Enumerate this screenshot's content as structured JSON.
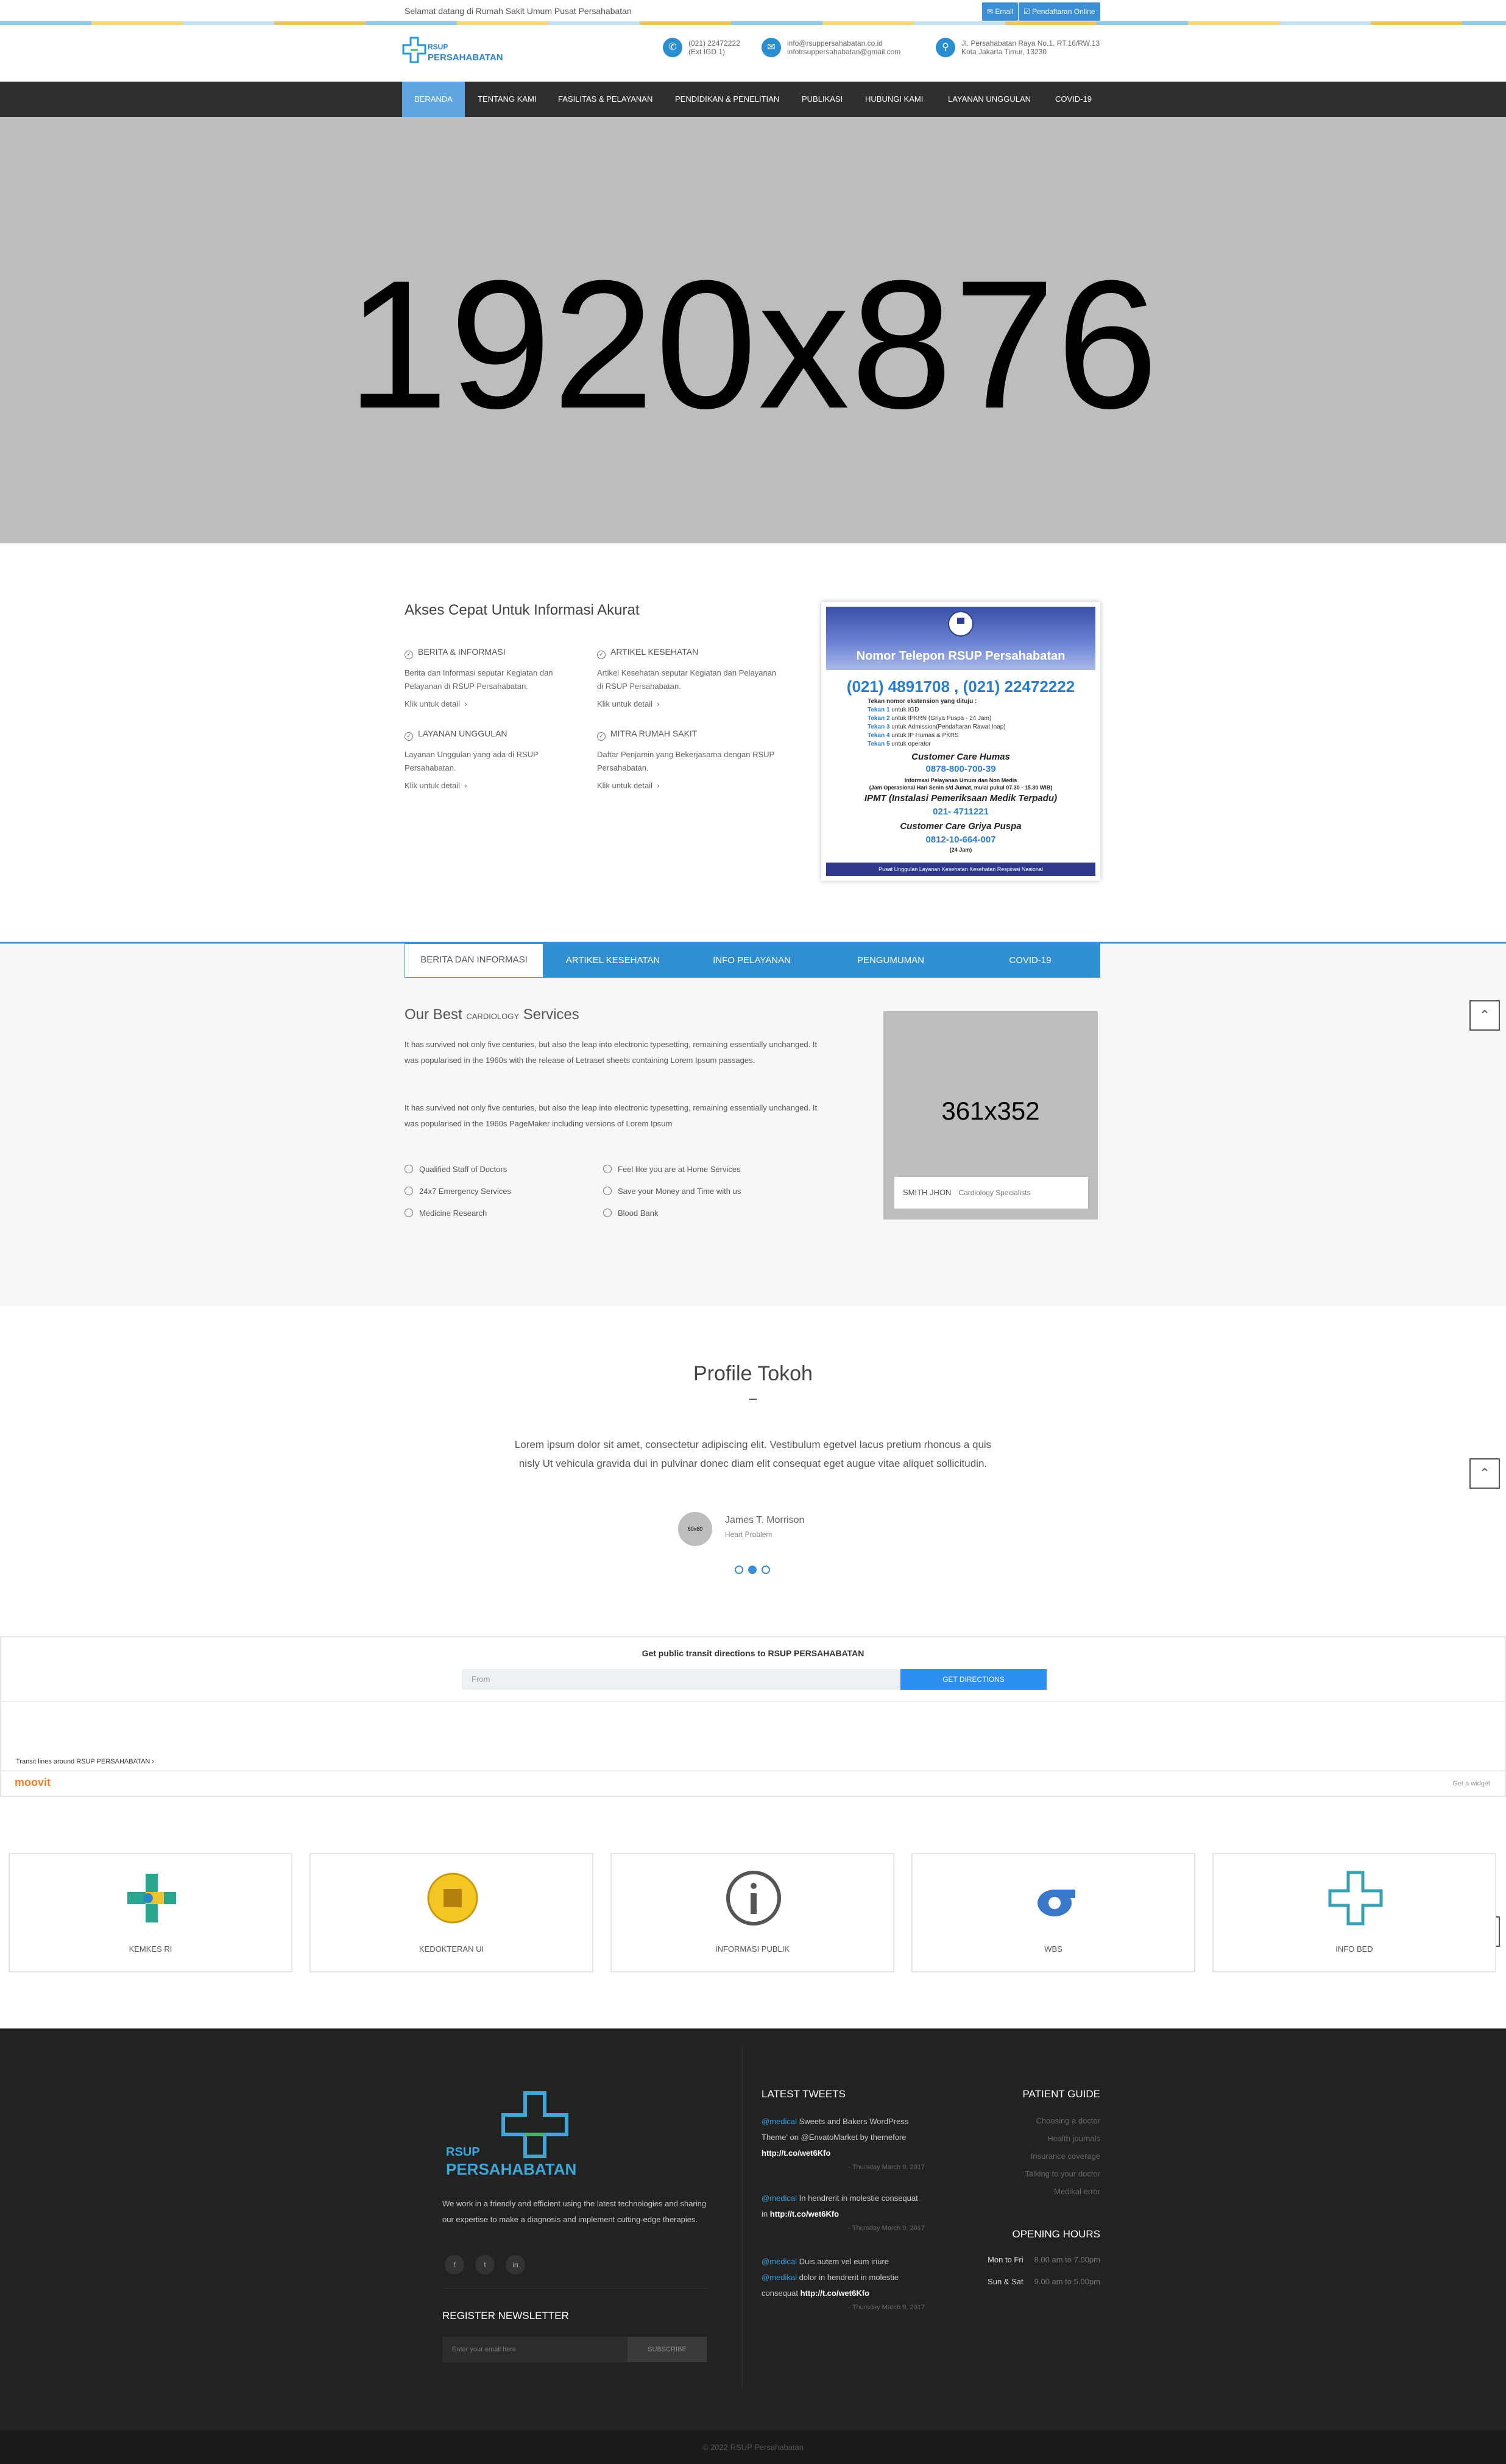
{
  "topbar": {
    "welcome": "Selamat datang di Rumah Sakit Umum Pusat Persahabatan",
    "email_btn": "✉ Email",
    "register_btn": "☑ Pendaftaran Online"
  },
  "header": {
    "logo_line1": "RSUP",
    "logo_line2": "PERSAHABATAN",
    "phone1": "(021) 22472222",
    "phone2": "(Ext IGD 1)",
    "email1": "info@rsuppersahabatan.co.id",
    "email2": "infotrsuppersahabatan@gmail.com",
    "addr1": "Jl. Persahabatan Raya No.1, RT.16/RW.13",
    "addr2": "Kota Jakarta Timur, 13230"
  },
  "nav": [
    "BERANDA",
    "TENTANG KAMI",
    "FASILITAS & PELAYANAN",
    "PENDIDIKAN & PENELITIAN",
    "PUBLIKASI",
    "HUBUNGI KAMI",
    "LAYANAN UNGGULAN",
    "COVID-19"
  ],
  "hero": {
    "placeholder": "1920x876"
  },
  "quick": {
    "title": "Akses Cepat Untuk Informasi Akurat",
    "items": [
      {
        "title": "BERITA & INFORMASI",
        "desc": "Berita dan Informasi seputar Kegiatan dan Pelayanan di RSUP Persahabatan.",
        "link": "Klik untuk detail"
      },
      {
        "title": "ARTIKEL KESEHATAN",
        "desc": "Artikel Kesehatan seputar Kegiatan dan Pelayanan di RSUP Persahabatan.",
        "link": "Klik untuk detail"
      },
      {
        "title": "LAYANAN UNGGULAN",
        "desc": "Layanan Unggulan yang ada di RSUP Persahabatan.",
        "link": "Klik untuk detail"
      },
      {
        "title": "MITRA RUMAH SAKIT",
        "desc": "Daftar Penjamin yang Bekerjasama dengan RSUP Persahabatan.",
        "link": "Klik untuk detail"
      }
    ]
  },
  "poster": {
    "heading": "Nomor Telepon RSUP Persahabatan",
    "phone": "(021) 4891708 , (021) 22472222",
    "intro": "Tekan nomor ekstension yang dituju :",
    "ext": [
      {
        "k": "Tekan 1",
        "v": "untuk IGD"
      },
      {
        "k": "Tekan 2",
        "v": "untuk IPKRN (Griya Puspa - 24 Jam)"
      },
      {
        "k": "Tekan 3",
        "v": "untuk Admission(Pendaftaran Rawat Inap)"
      },
      {
        "k": "Tekan 4",
        "v": "untuk IP Humas & PKRS"
      },
      {
        "k": "Tekan 5",
        "v": "untuk operator"
      }
    ],
    "cc_humas": "Customer Care Humas",
    "cc_humas_no": "0878-800-700-39",
    "info": "Informasi Pelayanan Umum dan Non Medis",
    "info_hours": "(Jam Operasional Hari Senin s/d Jumat, mulai pukul 07.30 - 15.30 WIB)",
    "ipmt": "IPMT (Instalasi Pemeriksaan Medik Terpadu)",
    "ipmt_no": "021- 4711221",
    "griya": "Customer Care Griya Puspa",
    "griya_no": "0812-10-664-007",
    "griya_hours": "(24 Jam)",
    "footer": "Pusat Unggulan Layanan Kesehatan Kesehatan Respirasi Nasional"
  },
  "tabs": [
    "BERITA DAN INFORMASI",
    "ARTIKEL KESEHATAN",
    "INFO PELAYANAN",
    "PENGUMUMAN",
    "COVID-19"
  ],
  "services": {
    "title_a": "Our Best",
    "title_b": "CARDIOLOGY",
    "title_c": "Services",
    "p1": "It has survived not only five centuries, but also the leap into electronic typesetting, remaining essentially unchanged. It was popularised in the 1960s with the release of Letraset sheets containing Lorem Ipsum passages.",
    "p2": "It has survived not only five centuries, but also the leap into electronic typesetting, remaining essentially unchanged. It was popularised in the 1960s PageMaker including versions of Lorem Ipsum",
    "features": [
      "Qualified Staff of Doctors",
      "Feel like you are at Home Services",
      "24x7 Emergency Services",
      "Save your Money and Time with us",
      "Medicine Research",
      "Blood Bank"
    ],
    "doctor_placeholder": "361x352",
    "doctor_name": "SMITH JHON",
    "doctor_role": "Cardiology Specialists"
  },
  "profile": {
    "title": "Profile Tokoh",
    "quote": "Lorem ipsum dolor sit amet, consectetur adipiscing elit. Vestibulum egetvel lacus pretium rhoncus a quis nisly Ut vehicula gravida dui in pulvinar donec diam elit consequat eget augue vitae aliquet sollicitudin.",
    "avatar": "60x60",
    "name": "James T. Morrison",
    "role": "Heart Problem"
  },
  "transit": {
    "heading": "Get public transit directions to RSUP PERSAHABATAN",
    "from_placeholder": "From",
    "button": "GET DIRECTIONS",
    "lines": "Transit lines around RSUP PERSAHABATAN ›",
    "brand": "moovit",
    "widget": "Get a widget"
  },
  "links": [
    "KEMKES RI",
    "KEDOKTERAN UI",
    "INFORMASI PUBLIK",
    "WBS",
    "INFO BED"
  ],
  "footer": {
    "logo_line1": "RSUP",
    "logo_line2": "PERSAHABATAN",
    "about": "We work in a friendly and efficient using the latest technologies and sharing our expertise to make a diagnosis and implement cutting-edge therapies.",
    "newsletter": "REGISTER NEWSLETTER",
    "email_placeholder": "Enter your email here",
    "subscribe": "SUBSCRIBE",
    "tweets_title": "LATEST TWEETS",
    "tweets": [
      {
        "at": "@medical",
        "text": "Sweets and Bakers WordPress Theme' on @EnvatoMarket by themefore",
        "url": "http://t.co/wet6Kfo",
        "date": "- Thursday March 9, 2017"
      },
      {
        "at": "@medical",
        "text": "In hendrerit in molestie consequat in",
        "url": "http://t.co/wet6Kfo",
        "date": "- Thursday March 9, 2017"
      },
      {
        "at": "@medical",
        "text": "Duis autem vel eum iriure",
        "at2": "@medikal",
        "text2": "dolor in hendrerit in molestie consequat",
        "url": "http://t.co/wet6Kfo",
        "date": "- Thursday March 9, 2017"
      }
    ],
    "guide_title": "PATIENT GUIDE",
    "guide": [
      "Choosing a doctor",
      "Health journals",
      "Insurance coverage",
      "Talking to your doctor",
      "Medikal error"
    ],
    "hours_title": "OPENING HOURS",
    "hours": [
      {
        "day": "Mon to Fri",
        "time": "8.00 am to 7.00pm"
      },
      {
        "day": "Sun & Sat",
        "time": "9.00 am to 5.00pm"
      }
    ],
    "copyright": "© 2022 RSUP Persahabatan"
  },
  "colors": {
    "primary": "#2f8fd2",
    "nav_bg": "#2f2f2f",
    "footer_bg": "#222222"
  }
}
